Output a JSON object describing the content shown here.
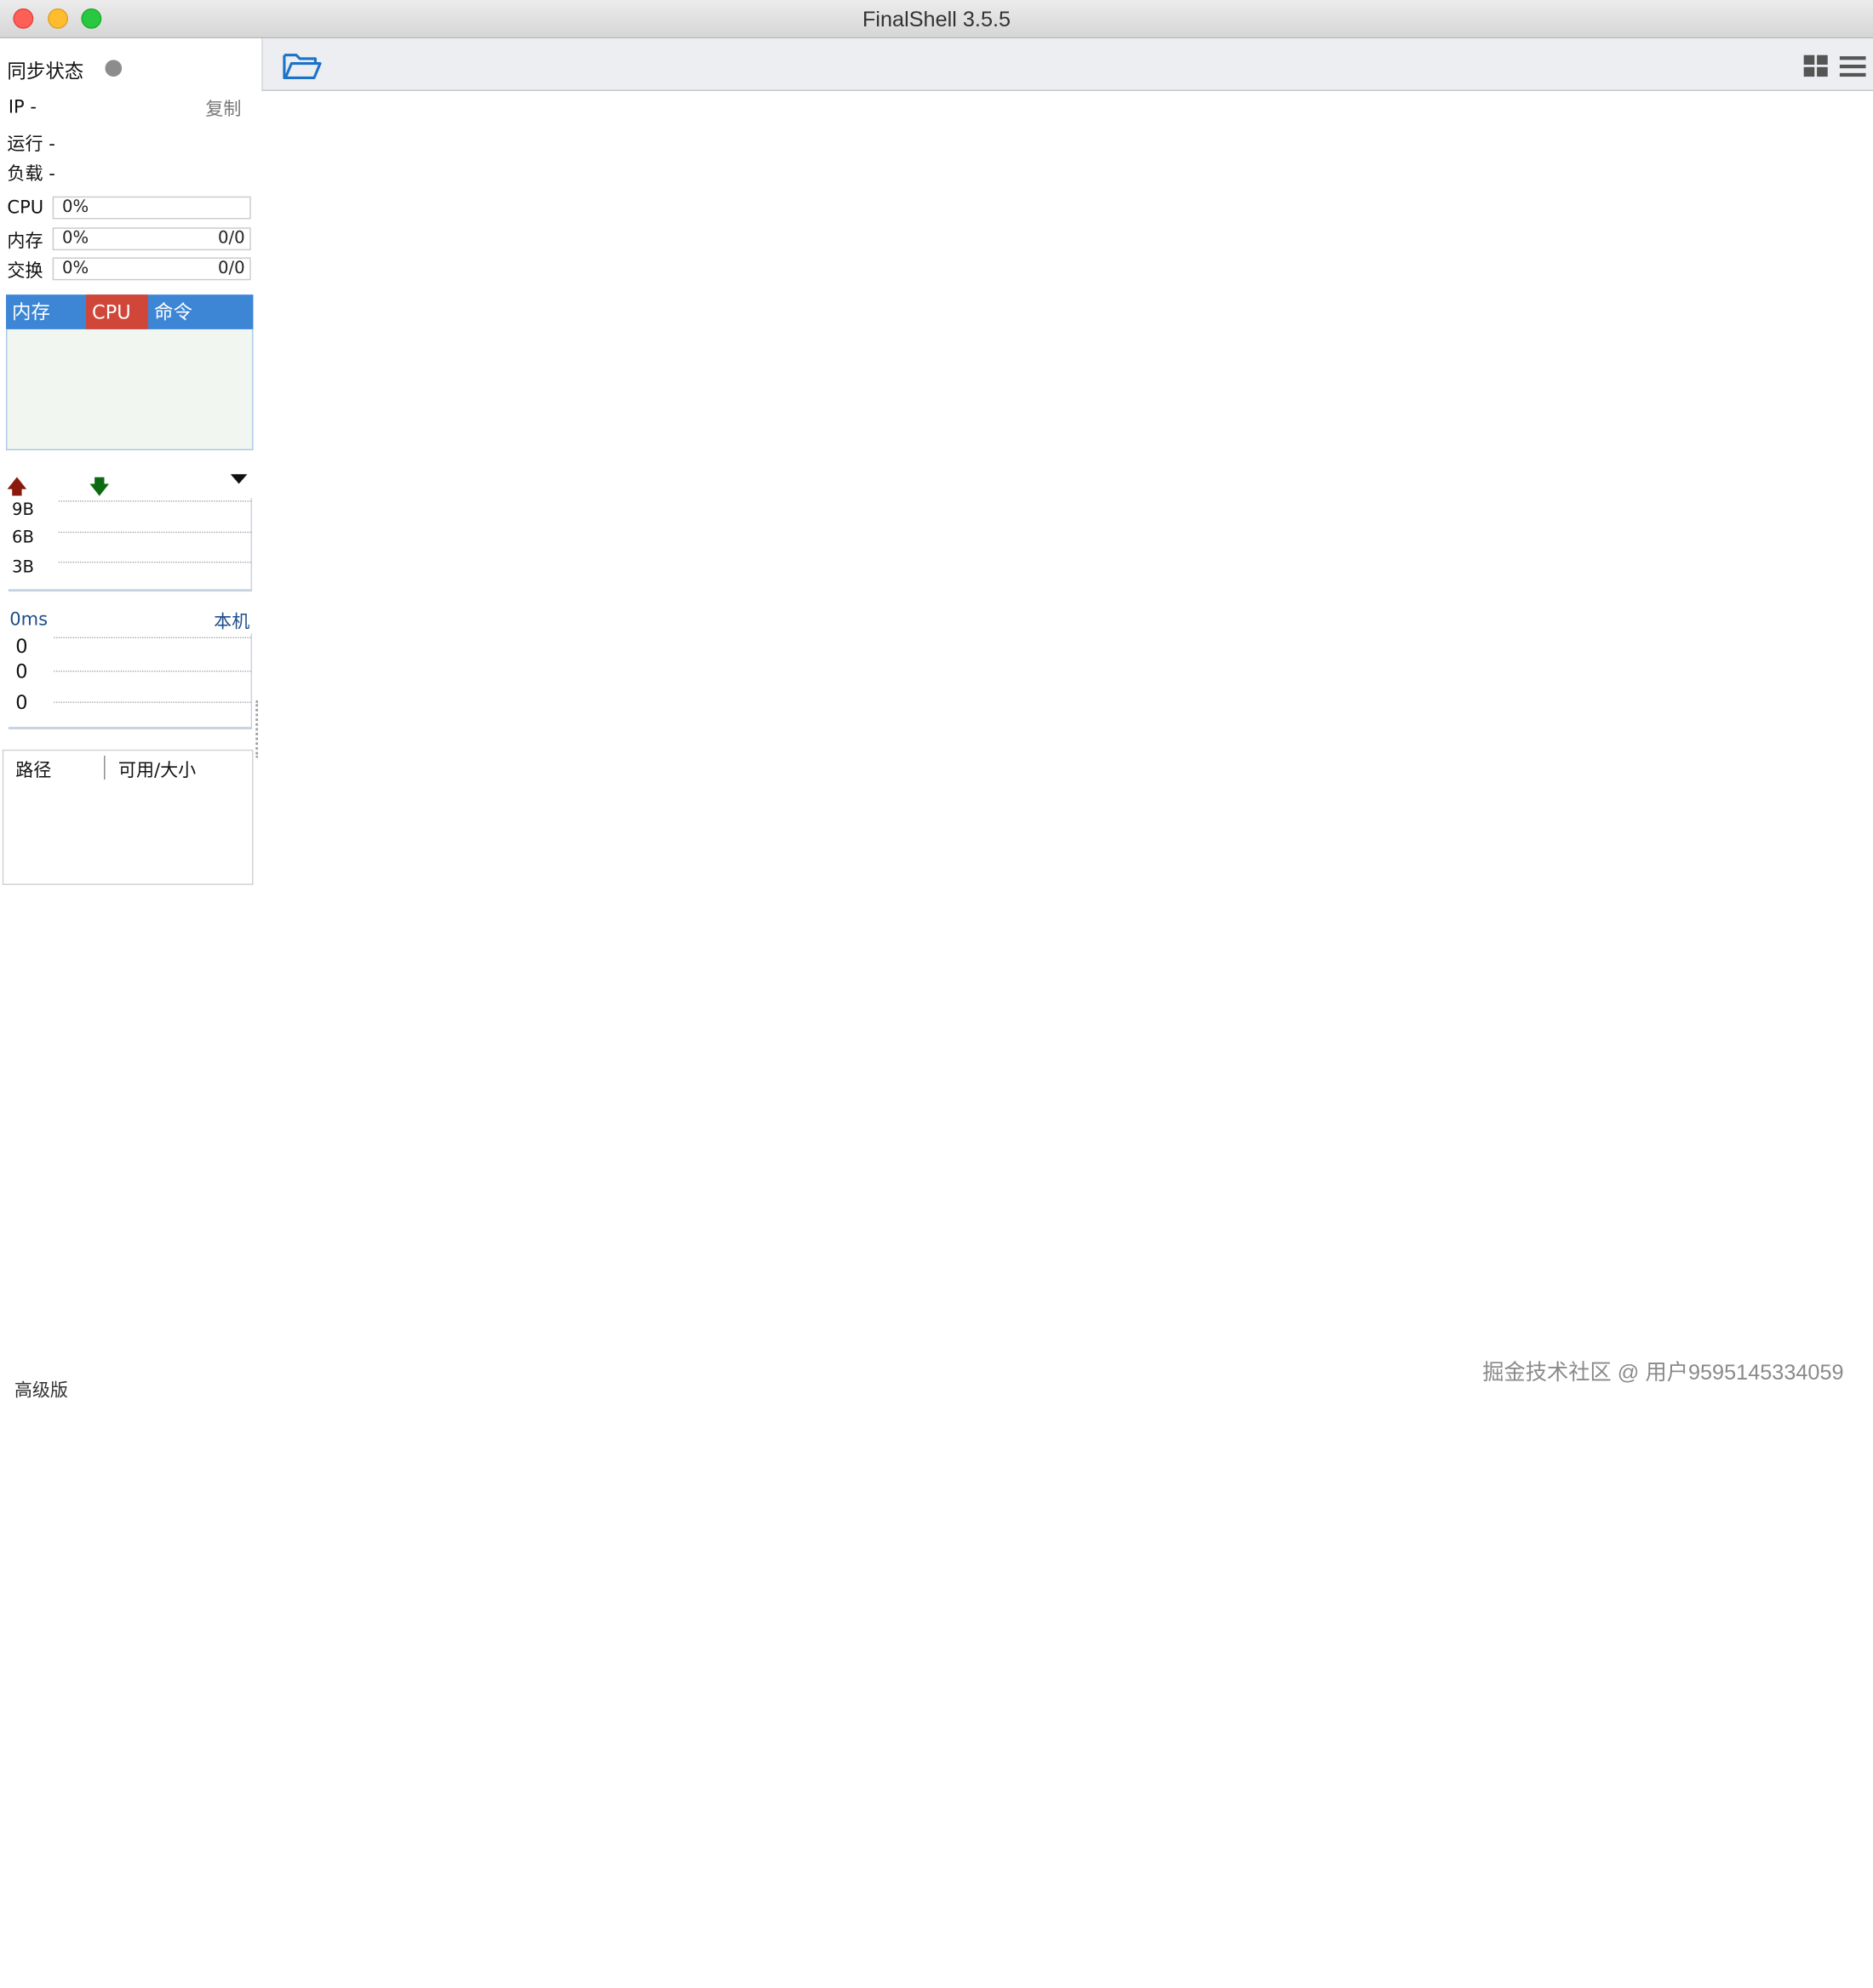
{
  "window": {
    "title": "FinalShell 3.5.5"
  },
  "sidebar": {
    "sync_status_label": "同步状态",
    "ip_label": "IP -",
    "copy_label": "复制",
    "uptime_label": "运行 -",
    "load_label": "负载 -",
    "meters": [
      {
        "label": "CPU",
        "percent": "0%",
        "ratio": ""
      },
      {
        "label": "内存",
        "percent": "0%",
        "ratio": "0/0"
      },
      {
        "label": "交换",
        "percent": "0%",
        "ratio": "0/0"
      }
    ],
    "process_tabs": [
      {
        "label": "内存",
        "active": false
      },
      {
        "label": "CPU",
        "active": true
      },
      {
        "label": "命令",
        "active": false
      }
    ],
    "network": {
      "y_ticks": [
        "9B",
        "6B",
        "3B"
      ]
    },
    "ping": {
      "latency": "0ms",
      "host": "本机",
      "y_ticks": [
        "0",
        "0",
        "0"
      ]
    },
    "disk_table": {
      "columns": [
        "路径",
        "可用/大小"
      ]
    },
    "edition_label": "高级版"
  },
  "watermark": "掘金技术社区 @ 用户9595145334059",
  "colors": {
    "tab_bar": "#3d86d6",
    "tab_active": "#d0473a",
    "upload_arrow": "#8b1a0e",
    "download_arrow": "#0c6b12",
    "ping_text": "#1e4e8c",
    "folder_icon": "#1a73c9"
  }
}
